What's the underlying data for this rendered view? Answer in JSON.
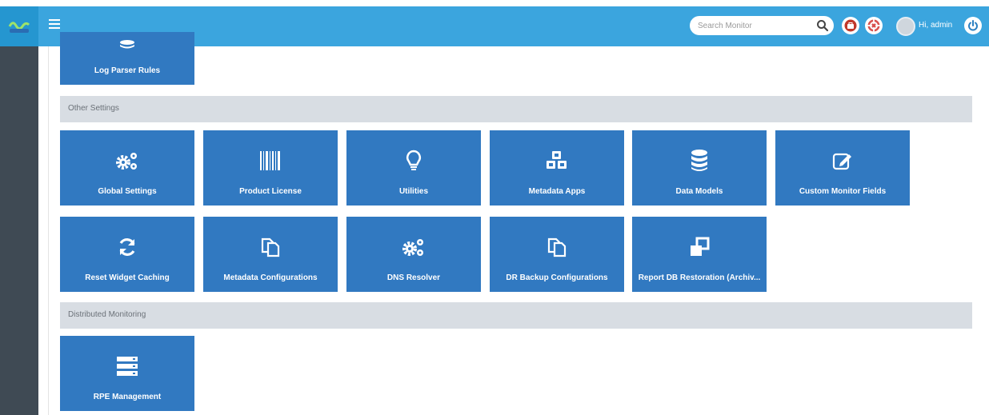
{
  "header": {
    "search": {
      "placeholder": "Search Monitor"
    },
    "user_greeting": "Hi, admin",
    "icons": [
      "logo-icon",
      "menu-icon",
      "search-icon",
      "briefcase-icon",
      "lifebuoy-icon",
      "avatar",
      "power-icon"
    ]
  },
  "top_tile": {
    "label": "Log Parser Rules",
    "icon": "database-icon"
  },
  "sections": {
    "other_settings": {
      "title": "Other Settings",
      "tiles": [
        {
          "label": "Global Settings",
          "icon": "cogs-icon"
        },
        {
          "label": "Product License",
          "icon": "barcode-icon"
        },
        {
          "label": "Utilities",
          "icon": "lightbulb-icon"
        },
        {
          "label": "Metadata Apps",
          "icon": "cubes-icon"
        },
        {
          "label": "Data Models",
          "icon": "database-icon"
        },
        {
          "label": "Custom Monitor Fields",
          "icon": "edit-icon"
        },
        {
          "label": "Reset Widget Caching",
          "icon": "refresh-icon"
        },
        {
          "label": "Metadata Configurations",
          "icon": "copy-icon"
        },
        {
          "label": "DNS Resolver",
          "icon": "cogs-icon"
        },
        {
          "label": "DR Backup Configurations",
          "icon": "copy-icon"
        },
        {
          "label": "Report DB Restoration (Archiv...",
          "icon": "restore-icon"
        }
      ]
    },
    "distributed_monitoring": {
      "title": "Distributed Monitoring",
      "tiles": [
        {
          "label": "RPE Management",
          "icon": "server-icon"
        }
      ]
    }
  },
  "colors": {
    "header": "#3ba5de",
    "sidebar": "#3f4a54",
    "tile": "#3179c1",
    "section_bar": "#d8dde3"
  }
}
